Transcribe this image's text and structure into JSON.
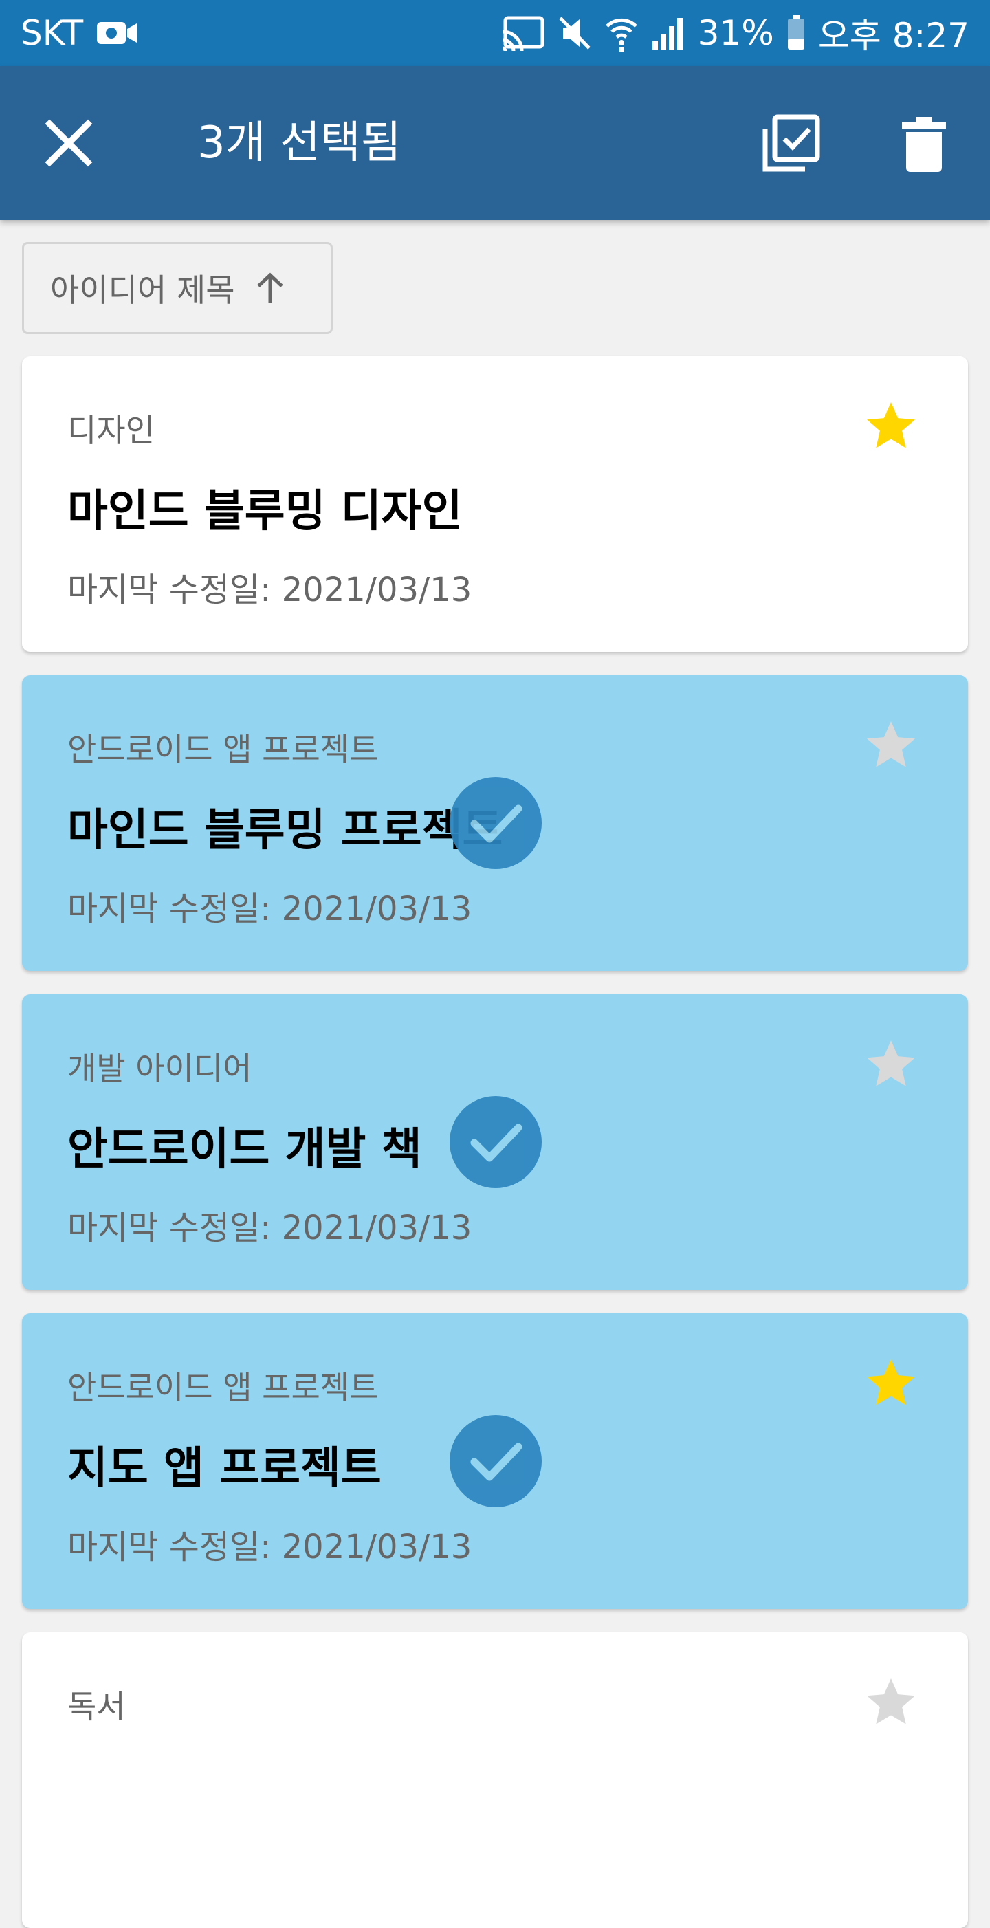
{
  "status_bar": {
    "carrier": "SKT",
    "battery": "31%",
    "time": "오후 8:27"
  },
  "app_bar": {
    "title": "3개 선택됨"
  },
  "sort": {
    "label": "아이디어 제목"
  },
  "ideas": [
    {
      "category": "디자인",
      "title": "마인드 블루밍 디자인",
      "modified": "마지막 수정일: 2021/03/13",
      "starred": true,
      "selected": false
    },
    {
      "category": "안드로이드 앱 프로젝트",
      "title": "마인드 블루밍 프로젝트",
      "modified": "마지막 수정일: 2021/03/13",
      "starred": false,
      "selected": true
    },
    {
      "category": "개발 아이디어",
      "title": "안드로이드 개발 책",
      "modified": "마지막 수정일: 2021/03/13",
      "starred": false,
      "selected": true
    },
    {
      "category": "안드로이드 앱 프로젝트",
      "title": "지도 앱 프로젝트",
      "modified": "마지막 수정일: 2021/03/13",
      "starred": true,
      "selected": true
    },
    {
      "category": "독서",
      "title": "",
      "modified": "",
      "starred": false,
      "selected": false
    }
  ],
  "colors": {
    "status_bar": "#1976b5",
    "app_bar": "#2a6496",
    "selected_card": "#93d4f0",
    "check_badge": "#2c86c0",
    "star_on": "#ffd600",
    "star_off": "#d9d9d9"
  }
}
